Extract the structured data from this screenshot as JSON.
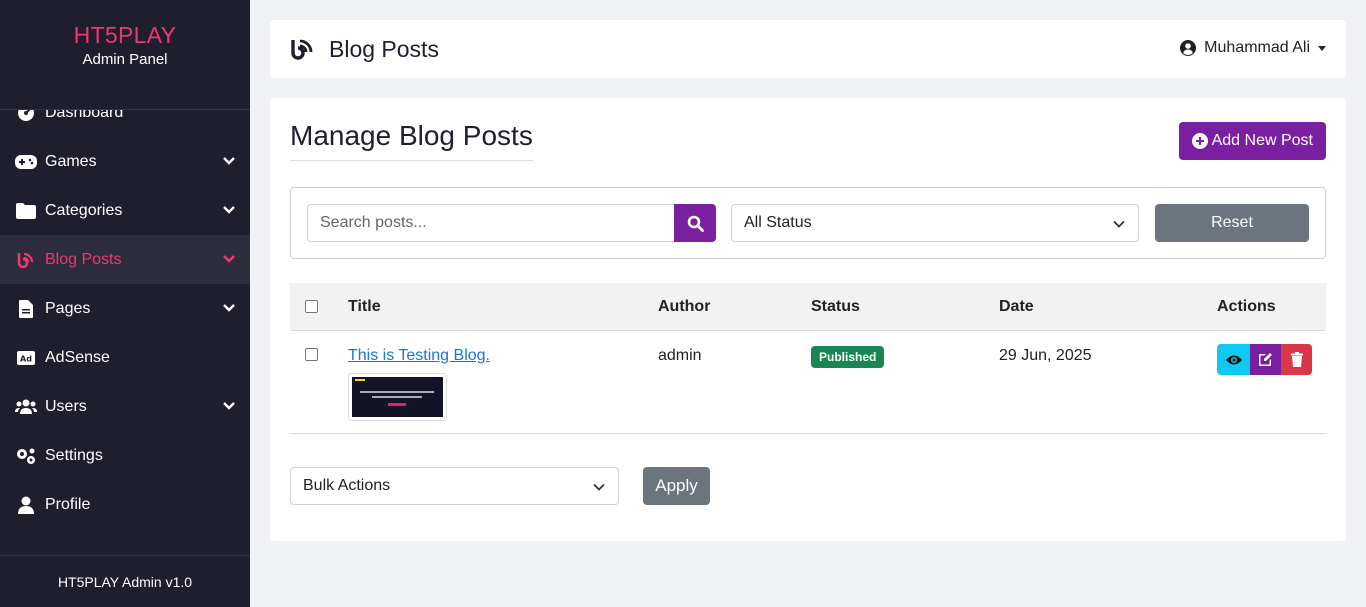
{
  "sidebar": {
    "brand": "HT5PLAY",
    "subtitle": "Admin Panel",
    "items": [
      {
        "label": "Dashboard",
        "icon": "gauge-icon"
      },
      {
        "label": "Games",
        "icon": "gamepad-icon"
      },
      {
        "label": "Categories",
        "icon": "folder-icon"
      },
      {
        "label": "Blog Posts",
        "icon": "blog-icon"
      },
      {
        "label": "Pages",
        "icon": "file-icon"
      },
      {
        "label": "AdSense",
        "icon": "ad-icon"
      },
      {
        "label": "Users",
        "icon": "users-icon"
      },
      {
        "label": "Settings",
        "icon": "cogs-icon"
      },
      {
        "label": "Profile",
        "icon": "user-icon"
      }
    ],
    "footer": "HT5PLAY Admin v1.0"
  },
  "header": {
    "title": "Blog Posts",
    "user": "Muhammad Ali"
  },
  "main": {
    "title": "Manage Blog Posts",
    "add_button": "Add New Post",
    "search_placeholder": "Search posts...",
    "status_filter": "All Status",
    "reset_button": "Reset",
    "columns": [
      "Title",
      "Author",
      "Status",
      "Date",
      "Actions"
    ],
    "rows": [
      {
        "title": "This is Testing Blog.",
        "author": "admin",
        "status": "Published",
        "date": "29 Jun, 2025"
      }
    ],
    "bulk_actions": "Bulk Actions",
    "apply_button": "Apply"
  },
  "colors": {
    "accent": "#f2376e",
    "primary": "#7b1fa2",
    "sidebar": "#1e1e2d",
    "success": "#198754",
    "info": "#0dcaf0",
    "danger": "#dc3545"
  }
}
